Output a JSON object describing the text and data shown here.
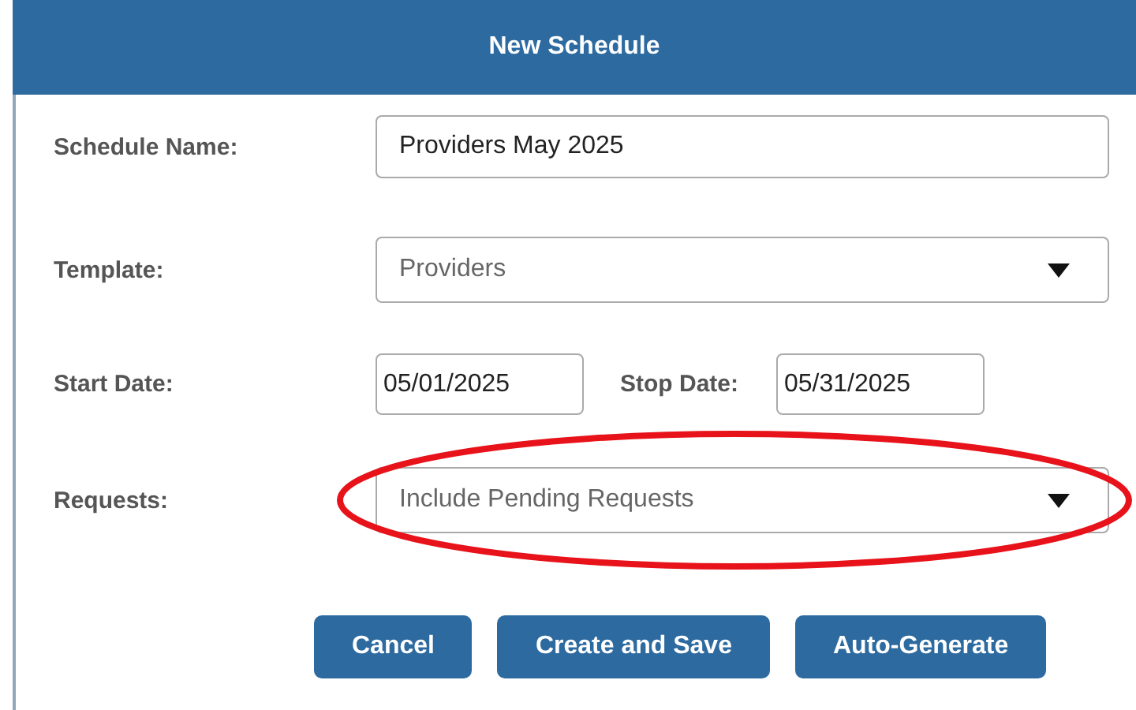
{
  "dialog": {
    "title": "New Schedule"
  },
  "fields": [
    {
      "kind": "text",
      "label": "Schedule Name:",
      "value": "Providers May 2025",
      "highlighted": false
    },
    {
      "kind": "select",
      "label": "Template:",
      "value": "Providers",
      "highlighted": false
    },
    {
      "kind": "dates",
      "label": "Start Date:",
      "value": "05/01/2025",
      "label_2": "Stop Date:",
      "value_2": "05/31/2025",
      "highlighted": false
    },
    {
      "kind": "select",
      "label": "Requests:",
      "value": "Include Pending Requests",
      "highlighted": true
    }
  ],
  "buttons": [
    "Cancel",
    "Create and Save",
    "Auto-Generate"
  ]
}
